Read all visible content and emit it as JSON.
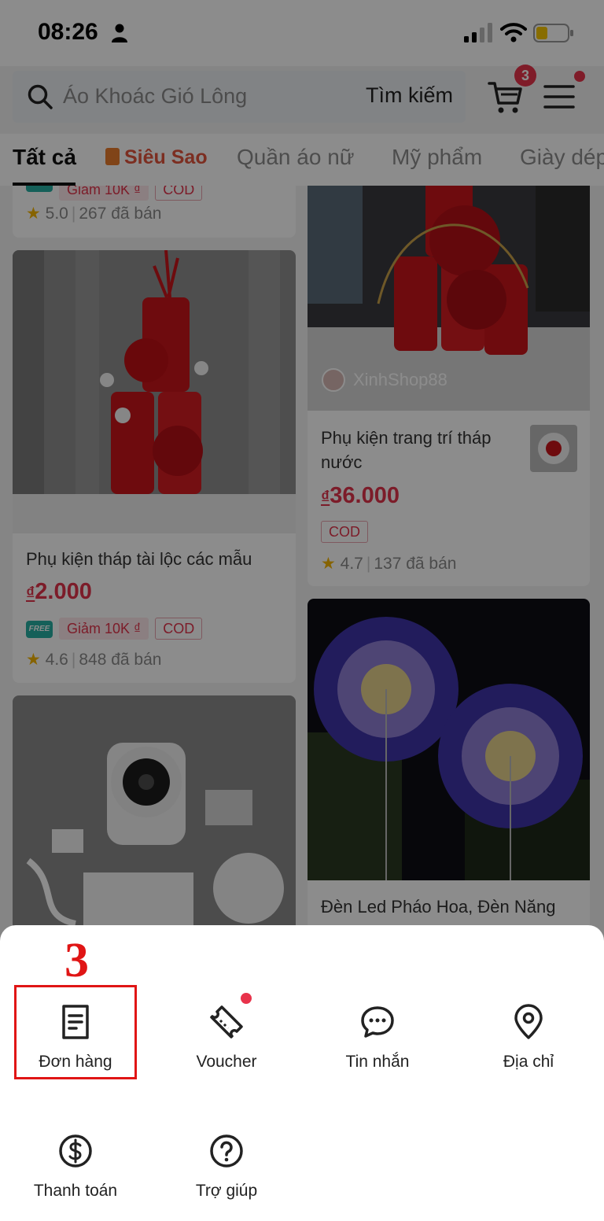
{
  "status_bar": {
    "time": "08:26"
  },
  "search": {
    "placeholder": "Áo Khoác Gió Lông",
    "button_label": "Tìm kiếm"
  },
  "cart": {
    "badge": "3"
  },
  "tabs": [
    {
      "label": "Tất cả"
    },
    {
      "label": "Siêu Sao"
    },
    {
      "label": "Quần áo nữ"
    },
    {
      "label": "Mỹ phẩm"
    },
    {
      "label": "Giày dép"
    }
  ],
  "products": [
    {
      "discount_tag": "Giảm 10K ₫",
      "cod_tag": "COD",
      "rating": "5.0",
      "sold": "267 đã bán"
    },
    {
      "shop": "XinhShop88",
      "title": "Phụ kiện trang trí tháp nước",
      "currency": "₫",
      "price": "36.000",
      "cod_tag": "COD",
      "rating": "4.7",
      "sold": "137 đã bán"
    },
    {
      "title": "Phụ kiện tháp tài lộc các mẫu",
      "currency": "₫",
      "price": "2.000",
      "free_icon": "FREE",
      "discount_tag": "Giảm 10K ₫",
      "cod_tag": "COD",
      "rating": "4.6",
      "sold": "848 đã bán"
    },
    {
      "title": "Đèn Led Pháo Hoa, Đèn Năng"
    }
  ],
  "annotation": {
    "step": "3"
  },
  "sheet": {
    "items": [
      {
        "label": "Đơn hàng",
        "icon": "order-icon"
      },
      {
        "label": "Voucher",
        "icon": "voucher-icon"
      },
      {
        "label": "Tin nhắn",
        "icon": "message-icon"
      },
      {
        "label": "Địa chỉ",
        "icon": "location-icon"
      },
      {
        "label": "Thanh toán",
        "icon": "dollar-icon"
      },
      {
        "label": "Trợ giúp",
        "icon": "help-icon"
      }
    ]
  },
  "colors": {
    "accent": "#e2344c",
    "highlight": "#e01515"
  }
}
